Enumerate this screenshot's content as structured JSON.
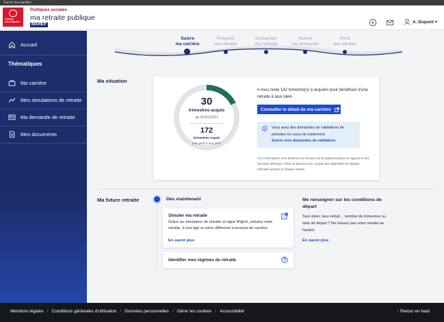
{
  "window": {
    "title": "Suivre ma carrière"
  },
  "header": {
    "logo_line1": "Caisse",
    "logo_line2": "des Dépôts",
    "brand_top": "Politiques sociales",
    "brand_main": "ma retraite publique",
    "brand_sub": "MAREP",
    "user_name": "A. Dupont"
  },
  "sidebar": {
    "home_label": "Accueil",
    "section_title": "Thématiques",
    "items": [
      {
        "label": "Ma carrière",
        "icon": "briefcase-icon"
      },
      {
        "label": "Mes simulations de retraite",
        "icon": "chart-line-icon"
      },
      {
        "label": "Ma demande de retraite",
        "icon": "id-card-icon"
      },
      {
        "label": "Mes documents",
        "icon": "document-icon"
      }
    ]
  },
  "stepper": {
    "steps": [
      {
        "line1": "Suivre",
        "line2": "ma carrière",
        "active": true
      },
      {
        "line1": "Préparer",
        "line2": "ma retraite",
        "active": false
      },
      {
        "line1": "Demander",
        "line2": "ma retraite",
        "active": false
      },
      {
        "line1": "Suivre",
        "line2": "ma demande",
        "active": false
      },
      {
        "line1": "Vivre",
        "line2": "ma retraite",
        "active": false
      }
    ]
  },
  "situation": {
    "title": "Ma situation",
    "acquired_count": "30",
    "acquired_label": "trimestres acquis",
    "acquired_date": "au 01/01/2021",
    "required_count": "172",
    "required_label": "trimestres requis",
    "required_sub": "pour partir à taux plein",
    "progress_fraction": 0.174,
    "remaining_text": "Il vous reste 142 trimestre(s) à acquérir pour bénéficier d'une retraite à taux plein",
    "detail_button": "Consulter le détail de ma carrière",
    "info_text": "Vous avez des demandes de validations de périodes en cours de traitement.",
    "info_link": "Suivre mes demandes de validation",
    "disclaimer": "Ces informations sont délivrées en fonction de la réglementation en vigueur et des données détenues. Elles ne tiennent pas compte des dispositifs de départs anticipés propres à chaque régime."
  },
  "future": {
    "title": "Ma future retraite",
    "timeline_label": "Dès maintenant",
    "simulate": {
      "title": "Simuler ma retraite",
      "desc": "Grâce au simulateur de retraite en ligne M@rel, simulez votre retraite, à tout âge et selon différents scénarios de carrière.",
      "link": "En savoir plus"
    },
    "identify": {
      "title": "Identifier mes régimes de retraite"
    },
    "conditions": {
      "title": "Me renseigner sur les conditions de départ",
      "desc": "Taux plein, taux réduit… nombre de trimestres ou date de départ ? Ne laissez pas votre retraite au hasard.",
      "link": "En savoir plus"
    }
  },
  "footer": {
    "links": [
      "Mentions légales",
      "Conditions générales d'utilisation",
      "Données personnelles",
      "Gérer les cookies",
      "Accessibilité"
    ],
    "back_to_top": "Retour en haut"
  },
  "colors": {
    "navy": "#1a2f6e",
    "accent_blue": "#1b4bd4",
    "progress_teal": "#1e6f5c",
    "brand_red": "#d7192d"
  }
}
